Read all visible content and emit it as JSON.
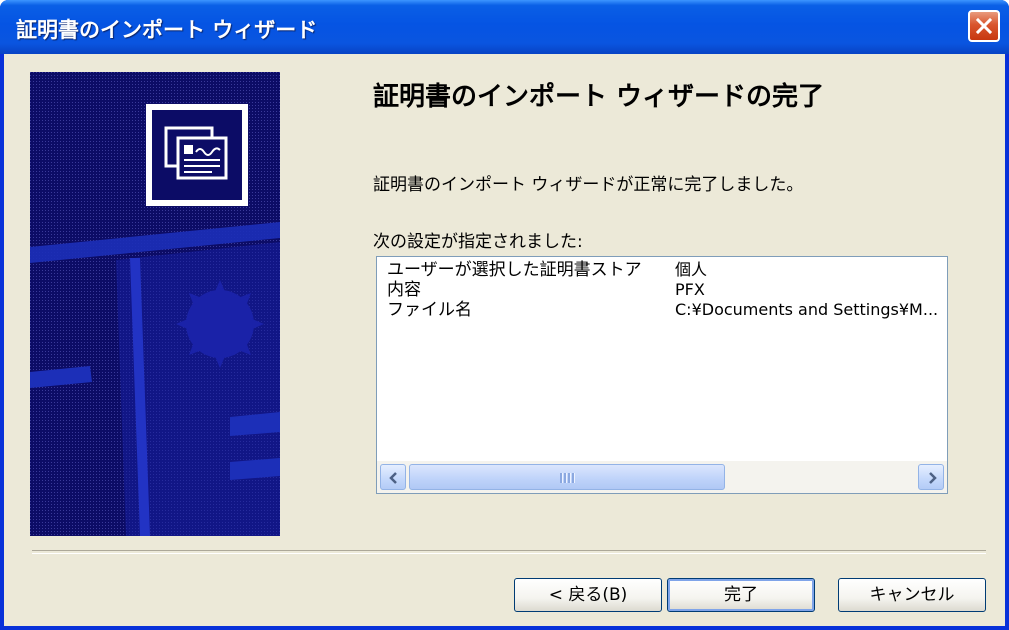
{
  "window": {
    "title": "証明書のインポート ウィザード",
    "close_label": "×"
  },
  "main": {
    "heading": "証明書のインポート ウィザードの完了",
    "message": "証明書のインポート ウィザードが正常に完了しました。",
    "settings_label": "次の設定が指定されました:",
    "settings": [
      {
        "name": "ユーザーが選択した証明書ストア",
        "value": "個人"
      },
      {
        "name": "内容",
        "value": "PFX"
      },
      {
        "name": "ファイル名",
        "value": "C:¥Documents and Settings¥M..."
      }
    ],
    "scrollbar": {
      "position": 0.0,
      "visible_fraction": 0.55
    }
  },
  "buttons": {
    "back": "< 戻る(B)",
    "finish": "完了",
    "cancel": "キャンセル"
  },
  "colors": {
    "titlebar": "#0554e3",
    "dialog_bg": "#ece9d8",
    "panel_bg": "#0c0c66",
    "close_button": "#d9562e"
  },
  "icons": [
    "close-icon",
    "certificate-icon",
    "arrow-left-icon",
    "arrow-right-icon"
  ]
}
